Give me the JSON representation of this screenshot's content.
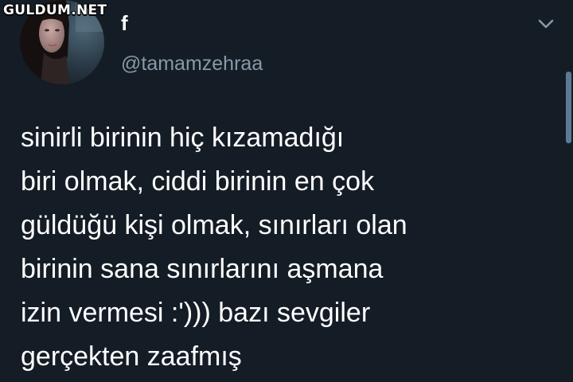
{
  "watermark": {
    "text": "GULDUM.NET"
  },
  "profile": {
    "display_name": "f",
    "username": "@tamamzehraa"
  },
  "icons": {
    "menu": "chevron-down-icon"
  },
  "tweet": {
    "text": "sinirli birinin hiç kızamadığı\nbiri olmak, ciddi birinin en çok\ngüldüğü kişi olmak, sınırları olan\nbirinin sana sınırlarını aşmana\nizin vermesi :'))) bazı sevgiler\ngerçekten zaafmış"
  },
  "colors": {
    "background": "#141d26",
    "text": "#ffffff",
    "secondary_text": "#8899a6",
    "scrollbar": "#5c7a95"
  }
}
